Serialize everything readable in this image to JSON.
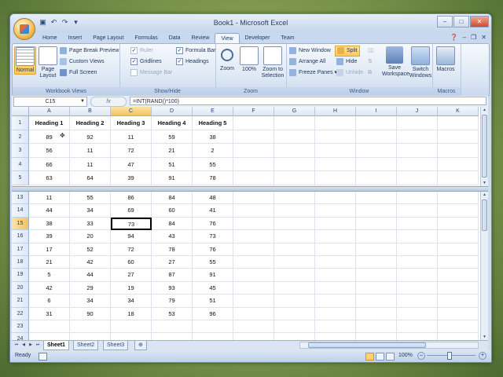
{
  "window": {
    "title": "Book1 - Microsoft Excel"
  },
  "qat": {
    "save_icon": "save-icon",
    "undo_icon": "undo-icon",
    "redo_icon": "redo-icon"
  },
  "tabs": [
    "Home",
    "Insert",
    "Page Layout",
    "Formulas",
    "Data",
    "Review",
    "View",
    "Developer",
    "Team"
  ],
  "active_tab": "View",
  "ribbon": {
    "workbook_views": {
      "label": "Workbook Views",
      "normal": "Normal",
      "page_layout": "Page Layout",
      "page_break_preview": "Page Break Preview",
      "custom_views": "Custom Views",
      "full_screen": "Full Screen"
    },
    "show_hide": {
      "label": "Show/Hide",
      "ruler": "Ruler",
      "gridlines": "Gridlines",
      "message_bar": "Message Bar",
      "formula_bar": "Formula Bar",
      "headings": "Headings"
    },
    "zoom": {
      "label": "Zoom",
      "zoom": "Zoom",
      "hundred": "100%",
      "zoom_to_selection": "Zoom to Selection"
    },
    "window": {
      "label": "Window",
      "new_window": "New Window",
      "arrange_all": "Arrange All",
      "freeze_panes": "Freeze Panes",
      "split": "Split",
      "hide": "Hide",
      "unhide": "Unhide",
      "save_workspace": "Save Workspace",
      "switch_windows": "Switch Windows"
    },
    "macros": {
      "label": "Macros",
      "macros": "Macros"
    }
  },
  "formula_bar": {
    "name_box": "C15",
    "fx": "fx",
    "formula": "=INT(RAND()*100)"
  },
  "columns": [
    "A",
    "B",
    "C",
    "D",
    "E",
    "F",
    "G",
    "H",
    "I",
    "J",
    "K"
  ],
  "selected_column": "C",
  "selected_row": "15",
  "top_pane": {
    "rows": [
      {
        "n": "1",
        "cells": [
          "Heading 1",
          "Heading 2",
          "Heading 3",
          "Heading 4",
          "Heading 5"
        ]
      },
      {
        "n": "2",
        "cells": [
          "89",
          "92",
          "11",
          "59",
          "38"
        ]
      },
      {
        "n": "3",
        "cells": [
          "56",
          "11",
          "72",
          "21",
          "2"
        ]
      },
      {
        "n": "4",
        "cells": [
          "66",
          "11",
          "47",
          "51",
          "55"
        ]
      },
      {
        "n": "5",
        "cells": [
          "63",
          "64",
          "39",
          "91",
          "78"
        ]
      }
    ]
  },
  "bottom_pane": {
    "rows": [
      {
        "n": "13",
        "cells": [
          "11",
          "55",
          "86",
          "84",
          "48"
        ]
      },
      {
        "n": "14",
        "cells": [
          "44",
          "34",
          "69",
          "60",
          "41"
        ]
      },
      {
        "n": "15",
        "cells": [
          "38",
          "33",
          "73",
          "84",
          "76"
        ]
      },
      {
        "n": "16",
        "cells": [
          "39",
          "20",
          "94",
          "43",
          "73"
        ]
      },
      {
        "n": "17",
        "cells": [
          "17",
          "52",
          "72",
          "78",
          "76"
        ]
      },
      {
        "n": "18",
        "cells": [
          "21",
          "42",
          "60",
          "27",
          "55"
        ]
      },
      {
        "n": "19",
        "cells": [
          "5",
          "44",
          "27",
          "87",
          "91"
        ]
      },
      {
        "n": "20",
        "cells": [
          "42",
          "29",
          "19",
          "93",
          "45"
        ]
      },
      {
        "n": "21",
        "cells": [
          "6",
          "34",
          "34",
          "79",
          "51"
        ]
      },
      {
        "n": "22",
        "cells": [
          "31",
          "90",
          "18",
          "53",
          "96"
        ]
      },
      {
        "n": "23",
        "cells": [
          "",
          "",
          "",
          "",
          ""
        ]
      },
      {
        "n": "24",
        "cells": [
          "",
          "",
          "",
          "",
          ""
        ]
      }
    ]
  },
  "sheets": [
    "Sheet1",
    "Sheet2",
    "Sheet3"
  ],
  "active_sheet": "Sheet1",
  "status": {
    "ready": "Ready",
    "zoom": "100%"
  },
  "colors": {
    "accent": "#f4c25e",
    "ribbon": "#dbe6f4"
  }
}
